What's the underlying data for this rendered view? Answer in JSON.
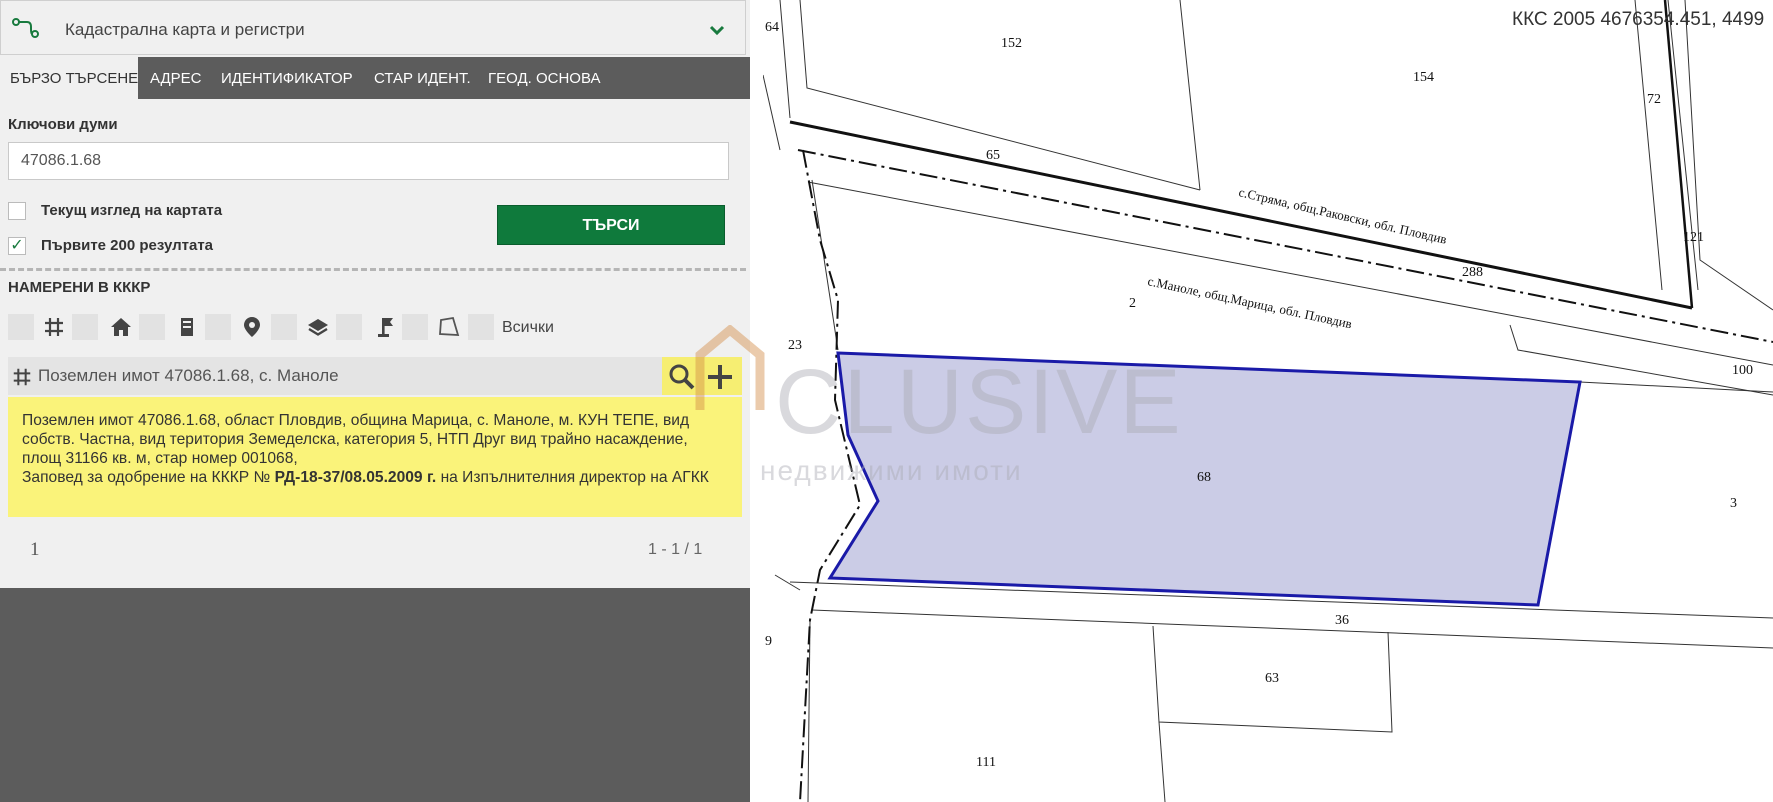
{
  "header": {
    "title": "Кадастрална карта и регистри"
  },
  "tabs": [
    "БЪРЗО ТЪРСЕНЕ",
    "АДРЕС",
    "ИДЕНТИФИКАТОР",
    "СТАР ИДЕНТ.",
    "ГЕОД. ОСНОВА"
  ],
  "search": {
    "keywords_label": "Ключови думи",
    "keywords_value": "47086.1.68",
    "current_view_label": "Текущ изглед на картата",
    "current_view_checked": false,
    "first200_label": "Първите 200 резултата",
    "first200_checked": true,
    "check_mark": "✓",
    "search_button": "ТЪРСИ"
  },
  "results": {
    "heading": "НАМЕРЕНИ В КККР",
    "filter_icons": [
      "empty",
      "grid-icon",
      "house-icon",
      "building-icon",
      "pin-icon",
      "layers-icon",
      "flag-icon",
      "polygon-icon",
      "empty"
    ],
    "filter_all_label": "Всички",
    "item_title": "Поземлен имот 47086.1.68, с. Маноле",
    "item_text": "Поземлен имот 47086.1.68, област Пловдив, община Марица, с. Маноле, м. КУН ТЕПЕ, вид собств. Частна, вид територия Земеделска, категория 5, НТП Друг вид трайно насаждение, площ 31166 кв. м, стар номер 001068,",
    "order_prefix": "Заповед за одобрение на КККР №",
    "order_number": "РД-18-37/08.05.2009 г.",
    "order_suffix": "на Изпълнителния директор на АГКК",
    "page": "1",
    "range": "1 - 1 / 1"
  },
  "map": {
    "coords": "ККС 2005 4676354.451, 4499",
    "parcel_labels": [
      "64",
      "152",
      "154",
      "72",
      "65",
      "121",
      "288",
      "2",
      "23",
      "100",
      "68",
      "3",
      "36",
      "63",
      "111",
      "9"
    ],
    "boundary_labels": [
      "с.Стряма, общ.Раковски, обл. Пловдив",
      "с.Маноле, общ.Марица, обл. Пловдив"
    ],
    "selected_fill": "#cbcce6",
    "selected_stroke": "#1a1aa8"
  },
  "watermark": {
    "big": "CLUSIVE",
    "small": "недвижими имоти"
  },
  "colors": {
    "accent": "#0f7a3c",
    "tabbar": "#5c5c5c",
    "highlight": "#faf37a"
  }
}
